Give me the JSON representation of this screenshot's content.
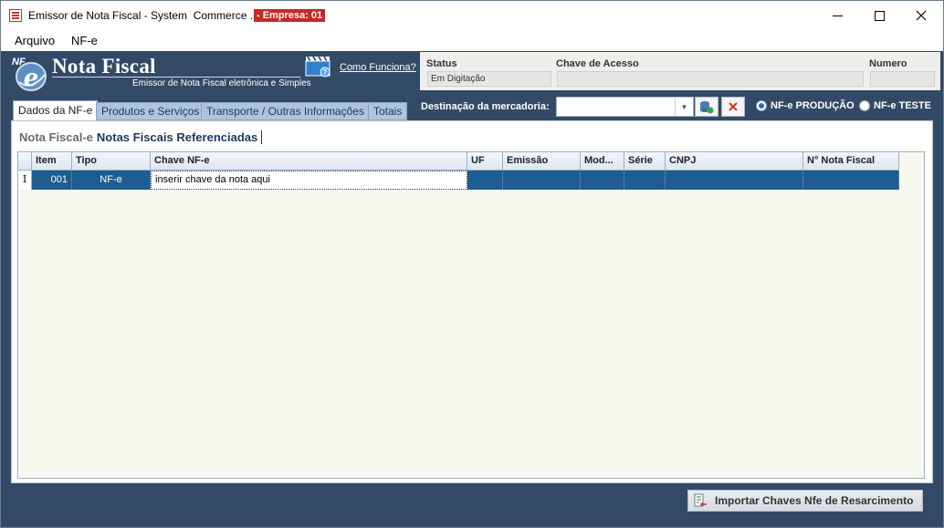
{
  "window": {
    "title": "Emissor de Nota Fiscal - System  Commerce .NET",
    "empresa_badge": "- Empresa: 01"
  },
  "menu": {
    "items": [
      {
        "label": "Arquivo"
      },
      {
        "label": "NF-e"
      }
    ]
  },
  "logo": {
    "badge": "NF",
    "emblem_letter": "e",
    "title": "Nota Fiscal",
    "subtitle": "Emissor de Nota Fiscal eletrônica e Simples",
    "help_link": "Como Funciona?"
  },
  "status_panel": {
    "status_label": "Status",
    "status_value": "Em Digitação",
    "chave_label": "Chave de Acesso",
    "chave_value": "",
    "numero_label": "Numero",
    "numero_value": ""
  },
  "tabs": [
    {
      "label": "Dados da NF-e",
      "active": true
    },
    {
      "label": "Produtos e Serviços",
      "active": false
    },
    {
      "label": "Transporte / Outras Informações",
      "active": false
    },
    {
      "label": "Totais",
      "active": false
    }
  ],
  "destination": {
    "label": "Destinação da mercadoria:",
    "value": ""
  },
  "environment": {
    "options": [
      {
        "label": "NF-e PRODUÇÃO",
        "checked": true
      },
      {
        "label": "NF-e TESTE",
        "checked": false
      }
    ]
  },
  "sub_tabs": [
    {
      "label": "Nota Fiscal-e",
      "active": false
    },
    {
      "label": "Notas Fiscais Referenciadas",
      "active": true
    }
  ],
  "grid": {
    "columns": [
      "Item",
      "Tipo",
      "Chave NF-e",
      "UF",
      "Emissão",
      "Mod...",
      "Série",
      "CNPJ",
      "N° Nota Fiscal"
    ],
    "rows": [
      {
        "indicator": "I",
        "item": "001",
        "tipo": "NF-e",
        "chave": "inserir chave da nota aqui",
        "uf": "",
        "emissao": "",
        "mod": "",
        "serie": "",
        "cnpj": "",
        "numero_nf": ""
      }
    ]
  },
  "buttons": {
    "import": "Importar Chaves Nfe de Resarcimento"
  },
  "colors": {
    "client_bg": "#334a67",
    "selected_row": "#1d5d91",
    "empresa_badge": "#c62828",
    "grid_bg": "#f7f8ee"
  }
}
